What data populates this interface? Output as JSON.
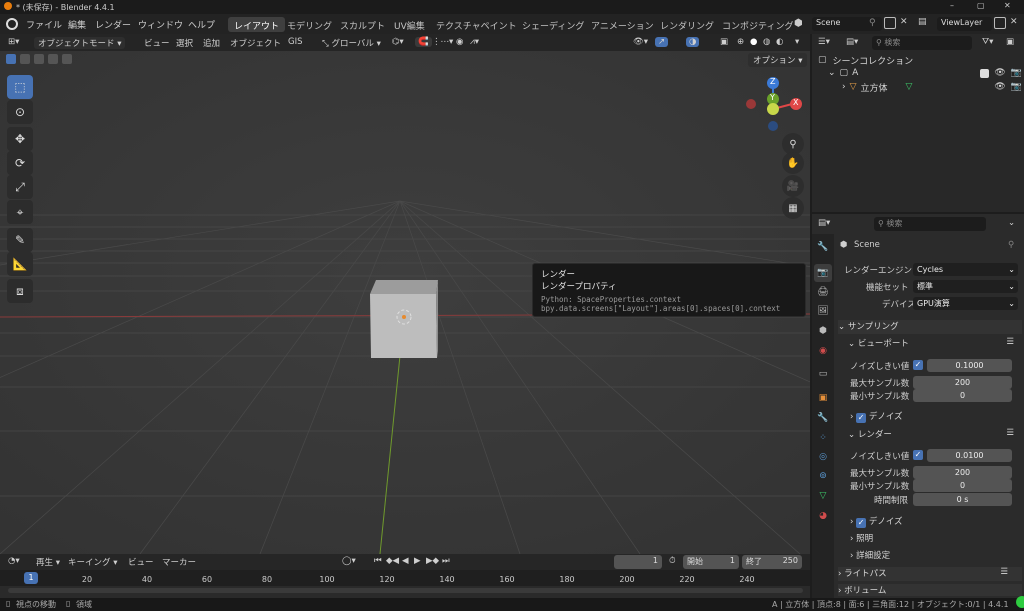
{
  "window": {
    "title": "* (未保存) - Blender 4.4.1",
    "controls": [
      "–",
      "▢",
      "✕"
    ]
  },
  "menu": {
    "items": [
      "ファイル",
      "編集",
      "レンダー",
      "ウィンドウ",
      "ヘルプ"
    ]
  },
  "workspaces": {
    "tabs": [
      "レイアウト",
      "モデリング",
      "スカルプト",
      "UV編集",
      "テクスチャペイント",
      "シェーディング",
      "アニメーション",
      "レンダリング",
      "コンポジティング"
    ],
    "active": "レイアウト"
  },
  "scene": {
    "name": "Scene",
    "view_layer": "ViewLayer"
  },
  "viewport_header": {
    "mode": "オブジェクトモード",
    "view": "ビュー",
    "select": "選択",
    "add": "追加",
    "object": "オブジェクト",
    "gis": "GIS",
    "orientation": "グローバル",
    "options": "オプション"
  },
  "gizmo": {
    "z": "Z",
    "y": "Y",
    "x": "X"
  },
  "tooltip": {
    "title": "レンダー",
    "subtitle": "レンダープロパティ",
    "python1": "Python: SpaceProperties.context",
    "python2": "bpy.data.screens[\"Layout\"].areas[0].spaces[0].context"
  },
  "outliner": {
    "search_placeholder": "検索",
    "root": "シーンコレクション",
    "collection": "A",
    "object": "立方体"
  },
  "properties": {
    "search_placeholder": "検索",
    "scene_label": "Scene",
    "render_engine_label": "レンダーエンジン",
    "render_engine": "Cycles",
    "feature_set_label": "機能セット",
    "feature_set": "標準",
    "device_label": "デバイス",
    "device": "GPU演算",
    "sampling": "サンプリング",
    "viewport": "ビューポート",
    "noise_threshold_label": "ノイズしきい値",
    "vp_noise_threshold": "0.1000",
    "max_samples_label": "最大サンプル数",
    "vp_max_samples": "200",
    "min_samples_label": "最小サンプル数",
    "vp_min_samples": "0",
    "denoise": "デノイズ",
    "render": "レンダー",
    "r_noise_threshold": "0.0100",
    "r_max_samples": "200",
    "r_min_samples": "0",
    "time_limit_label": "時間制限",
    "time_limit": "0 s",
    "lights": "照明",
    "advanced": "詳細設定",
    "light_paths": "ライトパス",
    "volumes": "ボリューム"
  },
  "timeline": {
    "playback": "再生",
    "keying": "キーイング",
    "view": "ビュー",
    "marker": "マーカー",
    "current_frame": "1",
    "start_label": "開始",
    "start": "1",
    "end_label": "終了",
    "end": "250",
    "ticks": [
      "20",
      "40",
      "60",
      "80",
      "100",
      "120",
      "140",
      "160",
      "180",
      "200",
      "220",
      "240"
    ],
    "playhead": "1"
  },
  "status": {
    "left1": "視点の移動",
    "left2": "領域",
    "right": "A | 立方体 | 頂点:8 | 面:6 | 三角面:12 | オブジェクト:0/1 | 4.4.1"
  }
}
